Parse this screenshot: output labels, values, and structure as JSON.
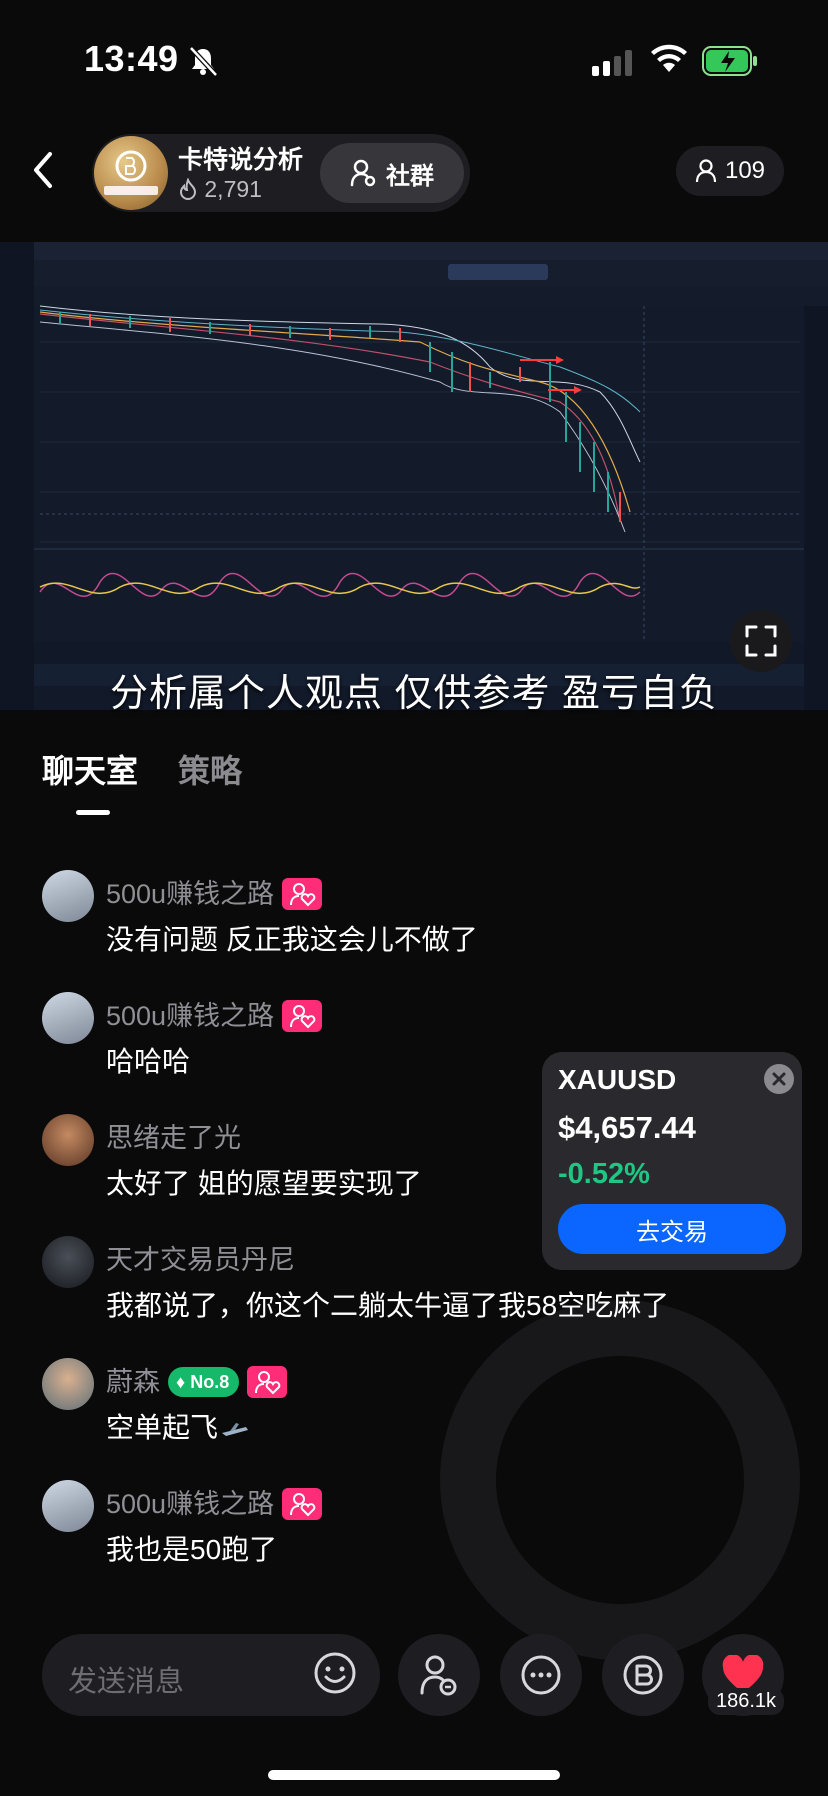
{
  "status_bar": {
    "time": "13:49"
  },
  "header": {
    "host_name": "卡特说分析",
    "host_fans": "2,791",
    "community_label": "社群",
    "viewer_count": "109"
  },
  "stream": {
    "caption": "分析属个人观点 仅供参考 盈亏自负"
  },
  "tabs": [
    {
      "label": "聊天室",
      "active": true
    },
    {
      "label": "策略",
      "active": false
    }
  ],
  "messages": [
    {
      "user": "500u赚钱之路",
      "text": "没有问题  反正我这会儿不做了",
      "fan_badge": true
    },
    {
      "user": "500u赚钱之路",
      "text": "哈哈哈",
      "fan_badge": true
    },
    {
      "user": "思绪走了光",
      "text": "太好了 姐的愿望要实现了",
      "fan_badge": false
    },
    {
      "user": "天才交易员丹尼",
      "text": "我都说了，你这个二躺太牛逼了我58空吃麻了",
      "fan_badge": false
    },
    {
      "user": "蔚森",
      "text": "空单起飞",
      "fan_badge": true,
      "level": "No.8"
    },
    {
      "user": "500u赚钱之路",
      "text": "我也是50跑了",
      "fan_badge": true
    }
  ],
  "ticker": {
    "symbol": "XAUUSD",
    "price": "$4,657.44",
    "change": "-0.52%",
    "trade_label": "去交易"
  },
  "bottom_bar": {
    "input_placeholder": "发送消息",
    "likes": "186.1k"
  },
  "colors": {
    "background": "#0a0a0b",
    "accent_blue": "#0a66ff",
    "positive_green": "#1fc784",
    "fan_badge_pink": "#ff2d78",
    "like_red": "#ff3350"
  }
}
